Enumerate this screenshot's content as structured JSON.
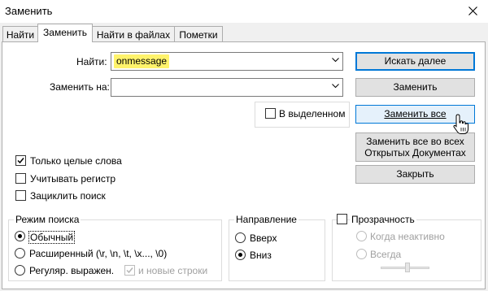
{
  "window": {
    "title": "Заменить"
  },
  "tabs": [
    {
      "label": "Найти"
    },
    {
      "label": "Заменить"
    },
    {
      "label": "Найти в файлах"
    },
    {
      "label": "Пометки"
    }
  ],
  "find": {
    "label": "Найти:",
    "value": "onmessage",
    "highlight_color": "#fff36b"
  },
  "replace": {
    "label": "Заменить на:",
    "value": ""
  },
  "in_selection": {
    "label": "В выделенном",
    "checked": false
  },
  "buttons": {
    "find_next": "Искать далее",
    "replace": "Заменить",
    "replace_all": "Заменить все",
    "replace_all_open_line1": "Заменить все во всех",
    "replace_all_open_line2": "Открытых Документах",
    "close": "Закрыть"
  },
  "options": {
    "whole_words": {
      "label": "Только целые слова",
      "checked": true
    },
    "match_case": {
      "label": "Учитывать регистр",
      "checked": false
    },
    "wrap_around": {
      "label": "Зациклить поиск",
      "checked": false
    }
  },
  "search_mode": {
    "title": "Режим поиска",
    "normal": "Обычный",
    "extended": "Расширенный (\\r, \\n, \\t, \\x..., \\0)",
    "regex": "Регуляр. выражен.",
    "newline": "и новые строки",
    "selected": "normal"
  },
  "direction": {
    "title": "Направление",
    "up": "Вверх",
    "down": "Вниз",
    "selected": "down"
  },
  "transparency": {
    "title": "Прозрачность",
    "checked": false,
    "on_losing_focus": "Когда неактивно",
    "always": "Всегда"
  }
}
